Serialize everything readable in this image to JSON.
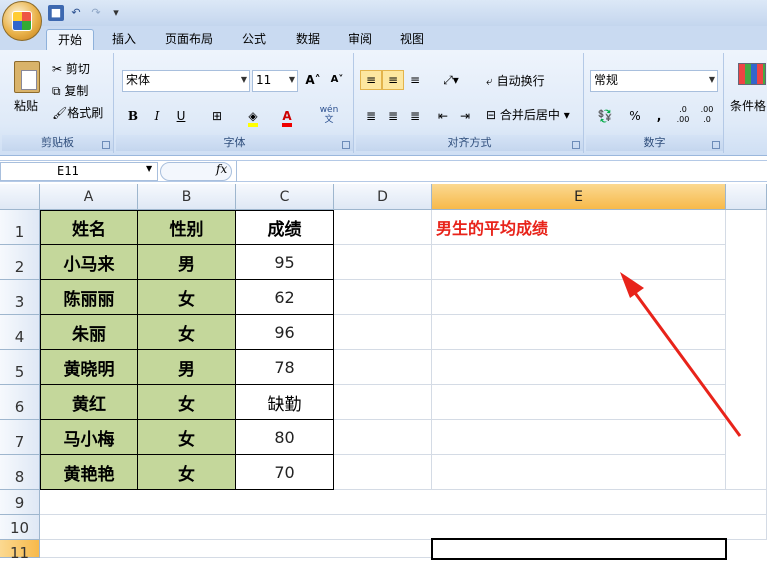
{
  "qat": {
    "save_icon": "save-icon",
    "undo_icon": "undo-icon",
    "redo_icon": "redo-icon"
  },
  "tabs": [
    "开始",
    "插入",
    "页面布局",
    "公式",
    "数据",
    "审阅",
    "视图"
  ],
  "ribbon": {
    "clipboard": {
      "paste": "粘贴",
      "cut": "剪切",
      "copy": "复制",
      "format_painter": "格式刷",
      "label": "剪贴板"
    },
    "font": {
      "name": "宋体",
      "size": "11",
      "bold": "B",
      "italic": "I",
      "underline": "U",
      "font_color": "A",
      "wen": "wén\n文",
      "label": "字体",
      "grow": "A",
      "shrink": "A"
    },
    "alignment": {
      "wrap": "自动换行",
      "merge": "合并后居中",
      "label": "对齐方式"
    },
    "number": {
      "format": "常规",
      "percent": "%",
      "comma": ",",
      "inc_dec": ".0\n.00",
      "dec_dec": ".00\n.0",
      "label": "数字"
    },
    "styles": {
      "conditional": "条件格"
    }
  },
  "formula_bar": {
    "name_box": "E11",
    "fx": "fx",
    "value": ""
  },
  "columns": [
    "A",
    "B",
    "C",
    "D",
    "E"
  ],
  "rows": [
    "1",
    "2",
    "3",
    "4",
    "5",
    "6",
    "7",
    "8",
    "9",
    "10",
    "11"
  ],
  "table": {
    "header": [
      "姓名",
      "性别",
      "成绩"
    ],
    "rows": [
      [
        "小马来",
        "男",
        "95"
      ],
      [
        "陈丽丽",
        "女",
        "62"
      ],
      [
        "朱丽",
        "女",
        "96"
      ],
      [
        "黄晓明",
        "男",
        "78"
      ],
      [
        "黄红",
        "女",
        "缺勤"
      ],
      [
        "马小梅",
        "女",
        "80"
      ],
      [
        "黄艳艳",
        "女",
        "70"
      ]
    ]
  },
  "e1_text": "男生的平均成绩",
  "colors": {
    "accent_red": "#e8231a",
    "header_green": "#c4d79b",
    "selected_header": "#f7b94a"
  }
}
